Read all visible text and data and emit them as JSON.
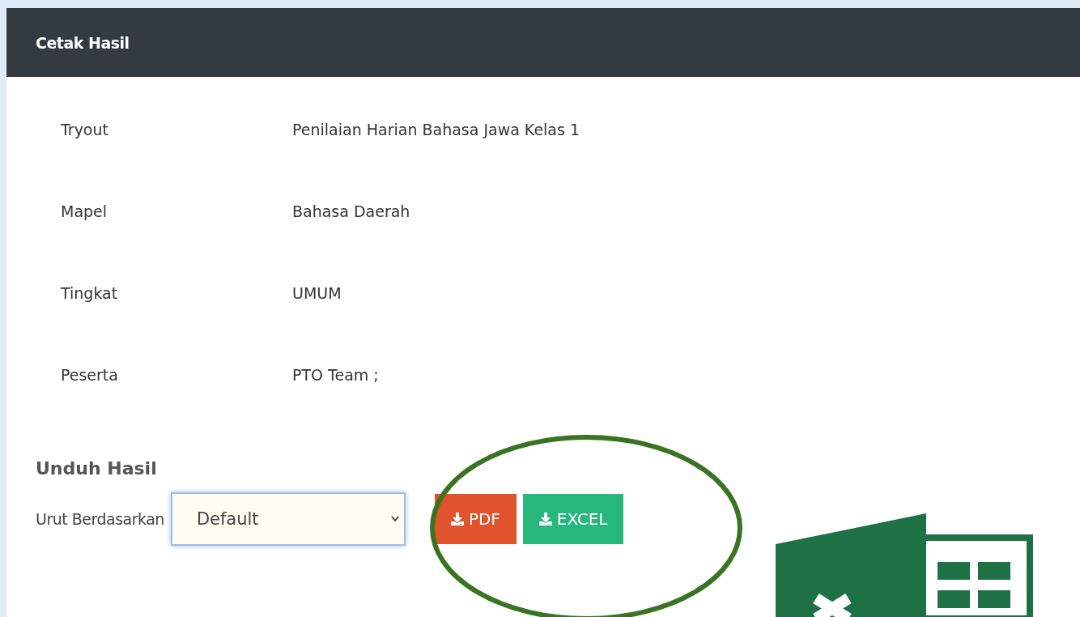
{
  "panel": {
    "title": "Cetak Hasil"
  },
  "details": [
    {
      "label": "Tryout",
      "value": "Penilaian Harian Bahasa Jawa Kelas 1"
    },
    {
      "label": "Mapel",
      "value": "Bahasa Daerah"
    },
    {
      "label": "Tingkat",
      "value": "UMUM"
    },
    {
      "label": "Peserta",
      "value": "PTO Team ;"
    }
  ],
  "download": {
    "heading": "Unduh Hasil",
    "sort_label": "Urut Berdasarkan",
    "sort_value": "Default",
    "buttons": [
      {
        "kind": "pdf",
        "label": "PDF"
      },
      {
        "kind": "excel",
        "label": "EXCEL"
      }
    ]
  }
}
